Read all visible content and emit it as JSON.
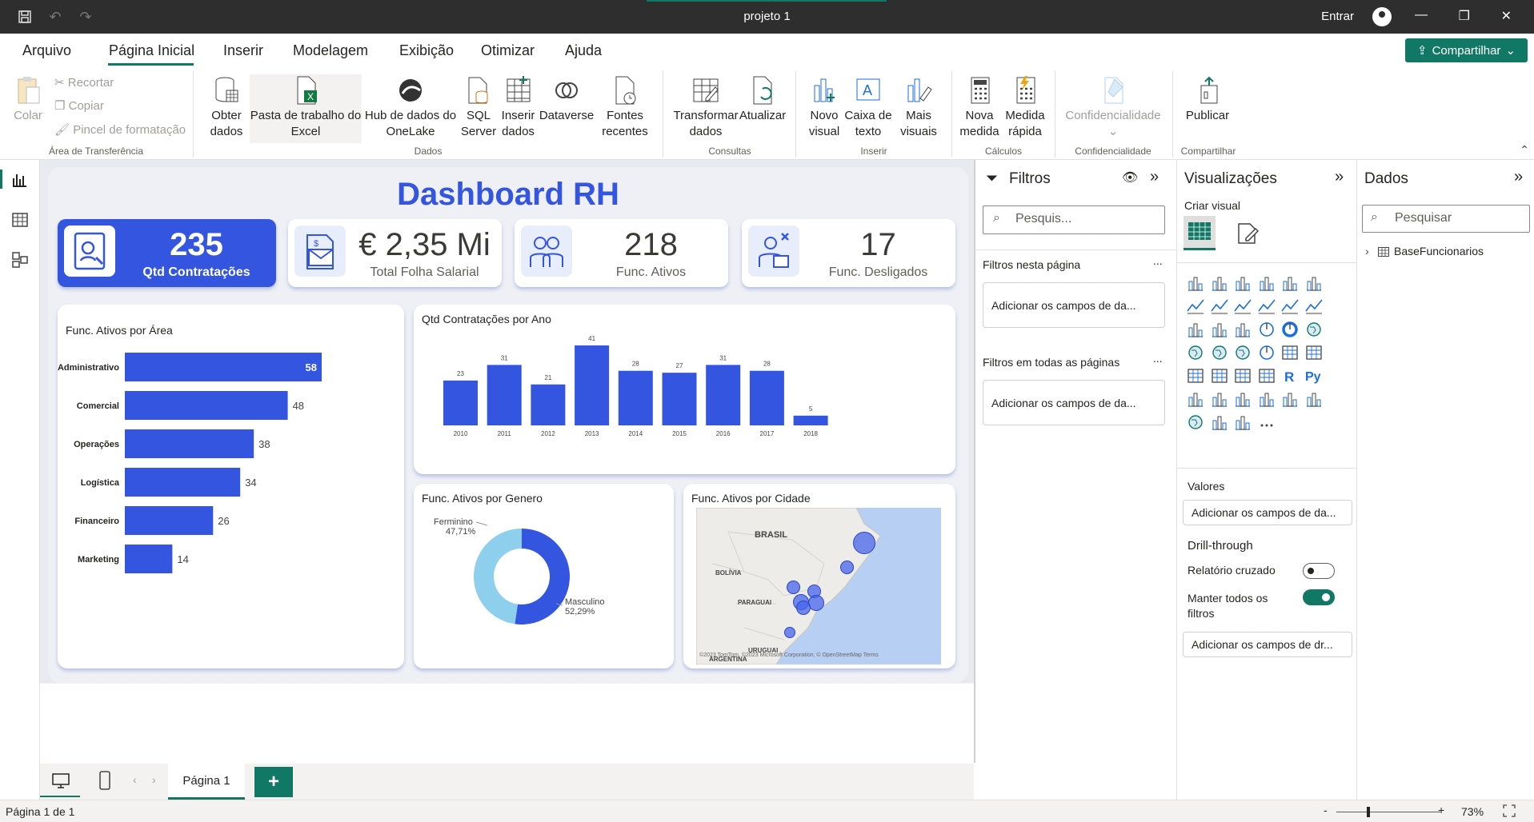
{
  "window": {
    "title": "projeto 1",
    "signin": "Entrar"
  },
  "menu": {
    "tabs": [
      "Arquivo",
      "Página Inicial",
      "Inserir",
      "Modelagem",
      "Exibição",
      "Otimizar",
      "Ajuda"
    ],
    "share": "Compartilhar"
  },
  "ribbon": {
    "clipboard": {
      "paste": "Colar",
      "cut": "Recortar",
      "copy": "Copiar",
      "format": "Pincel de formatação",
      "group": "Área de Transferência"
    },
    "data": {
      "get": "Obter\ndados",
      "excel": "Pasta de trabalho do\nExcel",
      "onelake": "Hub de dados do\nOneLake",
      "sql": "SQL\nServer",
      "enter": "Inserir\ndados",
      "dataverse": "Dataverse",
      "recent": "Fontes\nrecentes",
      "group": "Dados"
    },
    "queries": {
      "transform": "Transformar\ndados",
      "refresh": "Atualizar",
      "group": "Consultas"
    },
    "insert": {
      "visual": "Novo\nvisual",
      "textbox": "Caixa de\ntexto",
      "more": "Mais\nvisuais",
      "group": "Inserir"
    },
    "calc": {
      "measure": "Nova\nmedida",
      "quick": "Medida\nrápida",
      "group": "Cálculos"
    },
    "sensitivity": {
      "label": "Confidencialidade",
      "group": "Confidencialidade"
    },
    "share": {
      "publish": "Publicar",
      "group": "Compartilhar"
    }
  },
  "dashboard": {
    "title": "Dashboard RH",
    "kpis": [
      {
        "value": "235",
        "label": "Qtd Contratações"
      },
      {
        "value": "€ 2,35 Mi",
        "label": "Total Folha Salarial"
      },
      {
        "value": "218",
        "label": "Func. Ativos"
      },
      {
        "value": "17",
        "label": "Func. Desligados"
      }
    ],
    "area_title": "Func. Ativos por Área",
    "year_title": "Qtd Contratações por Ano",
    "gender_title": "Func. Ativos por Genero",
    "city_title": "Func. Ativos por Cidade",
    "map": {
      "brasil": "BRASIL",
      "bolivia": "BOLÍVIA",
      "paraguai": "PARAGUAI",
      "uruguai": "URUGUAI",
      "argentina": "ARGENTINA",
      "attribution": "©2023 TomTom, ©2023 Microsoft Corporation, © OpenStreetMap  Terms"
    }
  },
  "chart_data": [
    {
      "type": "bar",
      "orientation": "horizontal",
      "title": "Func. Ativos por Área",
      "categories": [
        "Administrativo",
        "Comercial",
        "Operações",
        "Logística",
        "Financeiro",
        "Marketing"
      ],
      "values": [
        58,
        48,
        38,
        34,
        26,
        14
      ],
      "color": "#3355e0"
    },
    {
      "type": "bar",
      "title": "Qtd Contratações por Ano",
      "categories": [
        "2010",
        "2011",
        "2012",
        "2013",
        "2014",
        "2015",
        "2016",
        "2017",
        "2018"
      ],
      "values": [
        23,
        31,
        21,
        41,
        28,
        27,
        31,
        28,
        5
      ],
      "color": "#3355e0"
    },
    {
      "type": "pie",
      "title": "Func. Ativos por Genero",
      "categories": [
        "Ferminino",
        "Masculino"
      ],
      "values": [
        47.71,
        52.29
      ],
      "labels": [
        "47,71%",
        "52,29%"
      ],
      "colors": [
        "#8ecfee",
        "#3355e0"
      ]
    }
  ],
  "filters": {
    "title": "Filtros",
    "search": "Pesquis...",
    "this_page": "Filtros nesta página",
    "all_pages": "Filtros em todas as páginas",
    "add": "Adicionar os campos de da...",
    "more": "..."
  },
  "viz": {
    "title": "Visualizações",
    "create": "Criar visual",
    "values": "Valores",
    "add_values": "Adicionar os campos de da...",
    "drill": "Drill-through",
    "cross": "Relatório cruzado",
    "keep": "Manter todos os\nfiltros",
    "add_drill": "Adicionar os campos de dr...",
    "more": "..."
  },
  "data": {
    "title": "Dados",
    "search": "Pesquisar",
    "table": "BaseFuncionarios"
  },
  "pages": {
    "tab": "Página 1",
    "add": "+"
  },
  "status": {
    "page": "Página 1 de 1",
    "zoom": "73%",
    "minus": "-",
    "plus": "+"
  },
  "colors": {
    "accent": "#117865",
    "primary": "#3355e0",
    "light": "#8ecfee"
  }
}
